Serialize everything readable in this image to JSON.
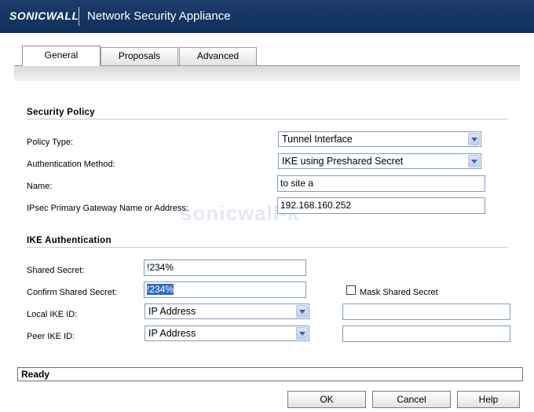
{
  "header": {
    "logo": "SONICWALL",
    "title": "Network Security Appliance"
  },
  "tabs": [
    {
      "label": "General",
      "active": true
    },
    {
      "label": "Proposals",
      "active": false
    },
    {
      "label": "Advanced",
      "active": false
    }
  ],
  "watermark": "sonicwall-k",
  "security_policy": {
    "title": "Security Policy",
    "policy_type_label": "Policy Type:",
    "policy_type_value": "Tunnel Interface",
    "auth_method_label": "Authentication Method:",
    "auth_method_value": "IKE using Preshared Secret",
    "name_label": "Name:",
    "name_value": "to site a",
    "gateway_label": "IPsec Primary Gateway Name or Address:",
    "gateway_value": "192.168.160.252"
  },
  "ike_auth": {
    "title": "IKE Authentication",
    "shared_secret_label": "Shared Secret:",
    "shared_secret_value": "!234%",
    "confirm_secret_label": "Confirm Shared Secret:",
    "confirm_secret_value": "!234%",
    "mask_label": "Mask Shared Secret",
    "mask_checked": false,
    "local_id_label": "Local IKE ID:",
    "local_id_type": "IP Address",
    "local_id_value": "",
    "peer_id_label": "Peer IKE ID:",
    "peer_id_type": "IP Address",
    "peer_id_value": ""
  },
  "status": "Ready",
  "buttons": {
    "ok": "OK",
    "cancel": "Cancel",
    "help": "Help"
  },
  "colors": {
    "header": "#0f2f5d",
    "selection": "#316ac5",
    "field_border": "#7f9db9"
  }
}
